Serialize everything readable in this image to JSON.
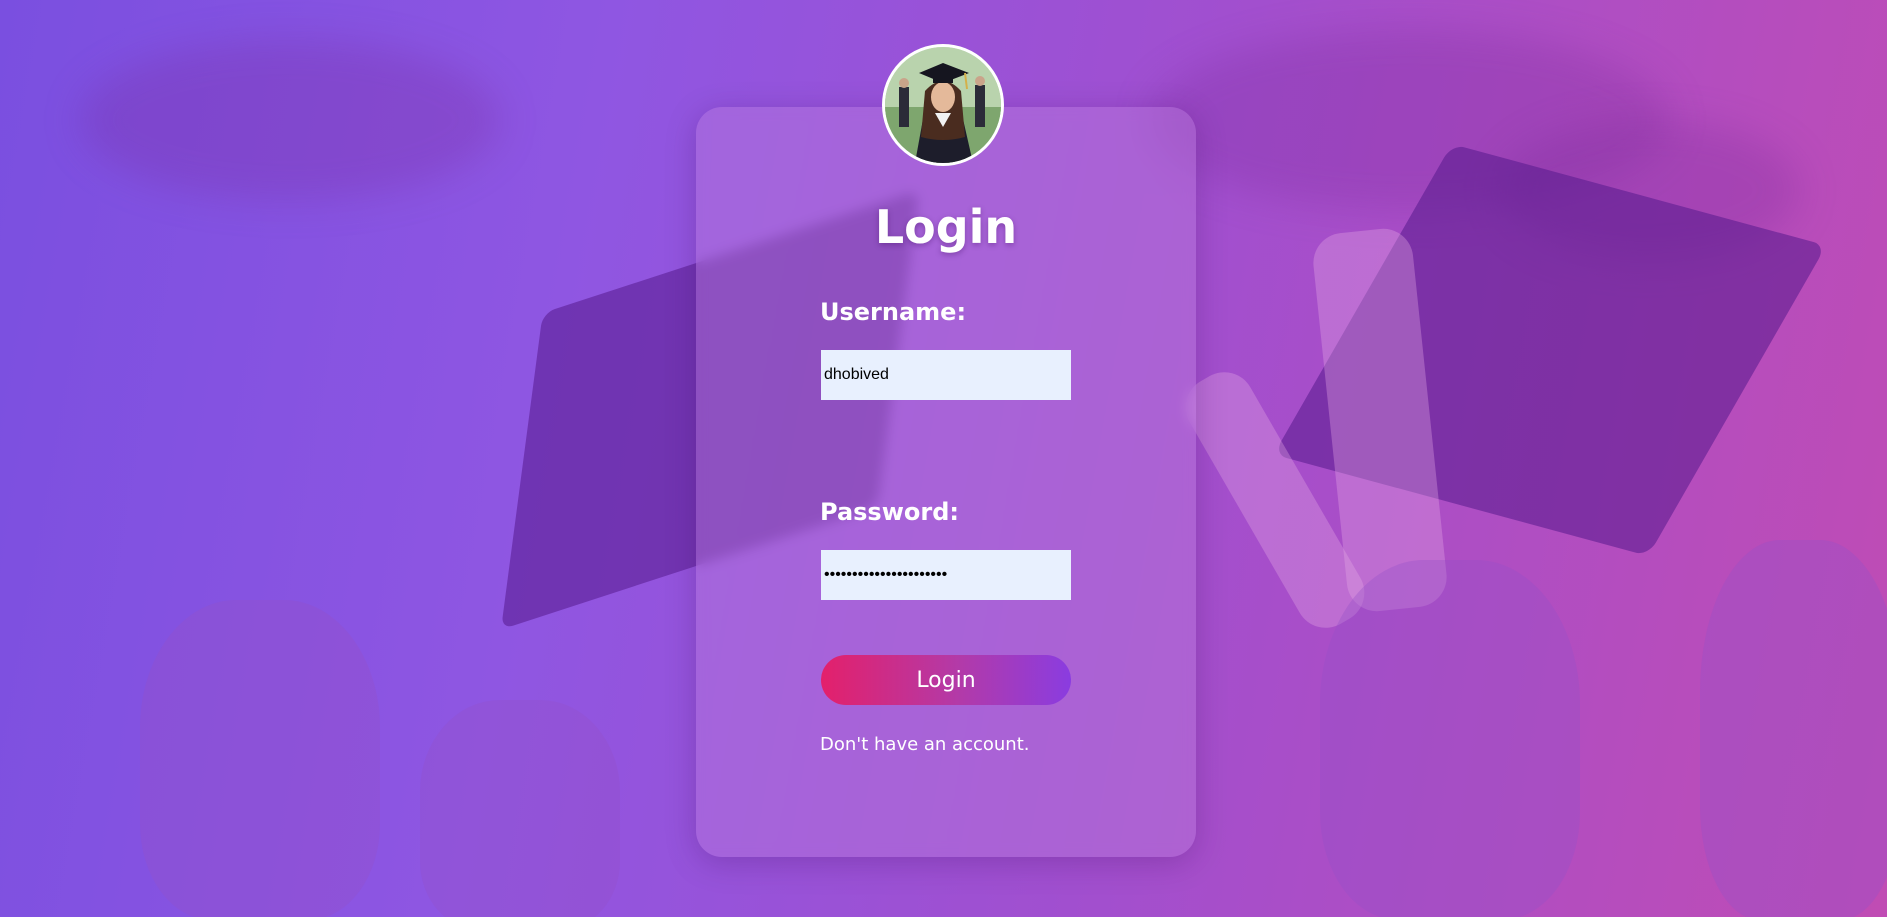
{
  "login": {
    "title": "Login",
    "username_label": "Username:",
    "username_value": "dhobived",
    "password_label": "Password:",
    "password_value": "••••••••••••••••••••••",
    "submit_label": "Login",
    "signup_text": "Don't have an account."
  },
  "theme": {
    "background_start": "#7a4fe0",
    "background_end": "#c04cb4",
    "button_start": "#e3206b",
    "button_end": "#8a3ce0",
    "input_bg": "#e8f0fe"
  },
  "icons": {
    "avatar": "graduate-avatar-photo"
  }
}
